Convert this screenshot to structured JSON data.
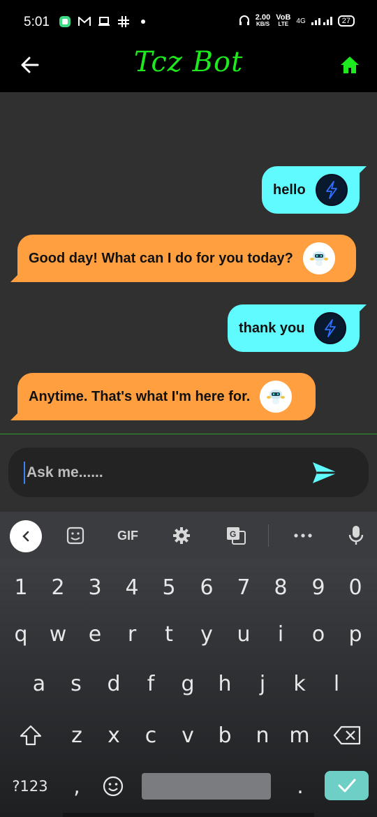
{
  "status_bar": {
    "time": "5:01",
    "speed_value": "2.00",
    "speed_unit": "KB/S",
    "network": "4G",
    "volte": "VoB",
    "lte": "LTE",
    "battery": "27"
  },
  "app_bar": {
    "title": "Tcz Bot",
    "title_color": "#1ee81e"
  },
  "messages": [
    {
      "sender": "user",
      "text": "hello"
    },
    {
      "sender": "bot",
      "text": "Good day! What can I do for you today?"
    },
    {
      "sender": "user",
      "text": "thank you"
    },
    {
      "sender": "bot",
      "text": "Anytime. That's what I'm here for."
    }
  ],
  "input": {
    "placeholder": "Ask me......",
    "value": ""
  },
  "colors": {
    "user_bubble": "#5ffbff",
    "bot_bubble": "#ff9f40",
    "accent": "#1ee81e",
    "send": "#5ffbff"
  },
  "keyboard": {
    "toolbar": {
      "gif": "GIF"
    },
    "numbers": [
      "1",
      "2",
      "3",
      "4",
      "5",
      "6",
      "7",
      "8",
      "9",
      "0"
    ],
    "row1": [
      "q",
      "w",
      "e",
      "r",
      "t",
      "y",
      "u",
      "i",
      "o",
      "p"
    ],
    "row2": [
      "a",
      "s",
      "d",
      "f",
      "g",
      "h",
      "j",
      "k",
      "l"
    ],
    "row3": [
      "z",
      "x",
      "c",
      "v",
      "b",
      "n",
      "m"
    ],
    "symbols_label": "?123",
    "comma": ",",
    "period": "."
  }
}
